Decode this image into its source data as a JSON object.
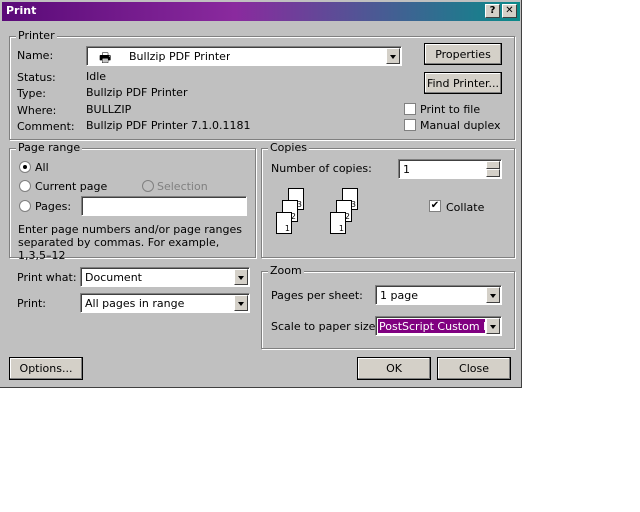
{
  "dialog": {
    "title": "Print"
  },
  "titlebar": {
    "help": "?",
    "close": "✕"
  },
  "printer": {
    "legend": "Printer",
    "name_label": "Name:",
    "name_value": "Bullzip PDF Printer",
    "status_label": "Status:",
    "status_value": "Idle",
    "type_label": "Type:",
    "type_value": "Bullzip PDF Printer",
    "where_label": "Where:",
    "where_value": "BULLZIP",
    "comment_label": "Comment:",
    "comment_value": "Bullzip PDF Printer 7.1.0.1181",
    "properties_button": "Properties",
    "find_printer_button": "Find Printer...",
    "print_to_file": "Print to file",
    "manual_duplex": "Manual duplex"
  },
  "page_range": {
    "legend": "Page range",
    "all": "All",
    "current_page": "Current page",
    "selection": "Selection",
    "pages": "Pages:",
    "pages_value": "",
    "hint": "Enter page numbers and/or page ranges separated by commas.  For example, 1,3,5–12"
  },
  "copies": {
    "legend": "Copies",
    "number_label": "Number of copies:",
    "number_value": "1",
    "collate": "Collate",
    "collate_checked": true
  },
  "print_what": {
    "label": "Print what:",
    "value": "Document"
  },
  "print": {
    "label": "Print:",
    "value": "All pages in range"
  },
  "zoom": {
    "legend": "Zoom",
    "pages_per_sheet_label": "Pages per sheet:",
    "pages_per_sheet_value": "1 page",
    "scale_label": "Scale to paper size:",
    "scale_value": "PostScript Custom Page"
  },
  "footer": {
    "options": "Options...",
    "ok": "OK",
    "close": "Close"
  },
  "colors": {
    "titlebar_start": "#5a0a78",
    "titlebar_end": "#0a8a8a",
    "selection": "#800080"
  }
}
